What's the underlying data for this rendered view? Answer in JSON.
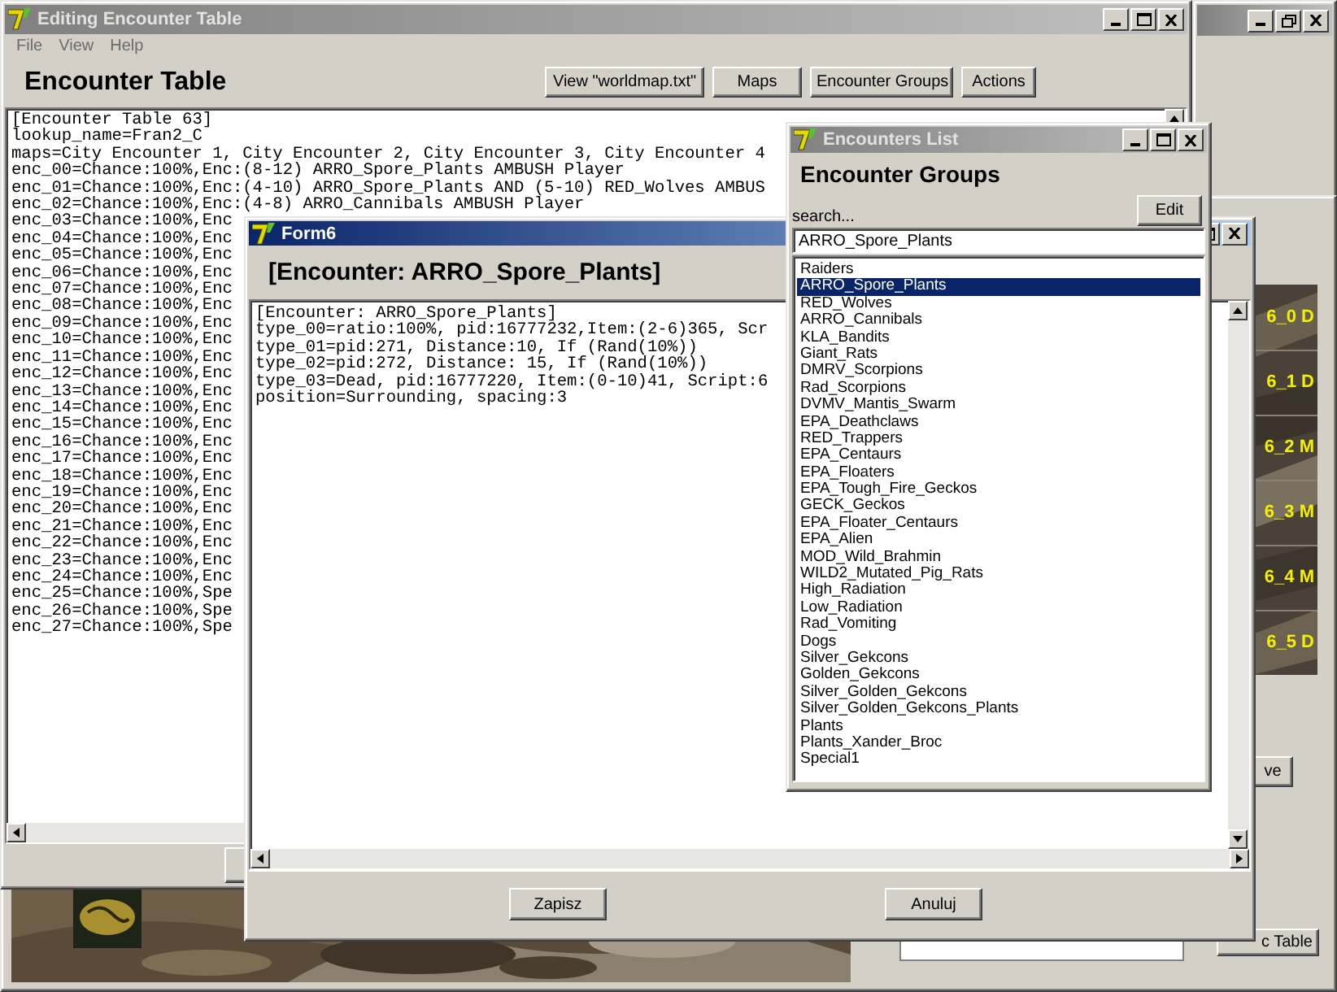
{
  "background_window": {
    "active": false
  },
  "main_window": {
    "title": "Editing Encounter Table",
    "active": false,
    "menu": [
      "File",
      "View",
      "Help"
    ],
    "heading": "Encounter Table",
    "buttons": [
      "View \"worldmap.txt\"",
      "Maps",
      "Encounter Groups",
      "Actions"
    ],
    "lines": [
      "[Encounter Table 63]",
      "lookup_name=Fran2_C",
      "maps=City Encounter 1, City Encounter 2, City Encounter 3, City Encounter 4",
      "enc_00=Chance:100%,Enc:(8-12) ARRO_Spore_Plants AMBUSH Player",
      "enc_01=Chance:100%,Enc:(4-10) ARRO_Spore_Plants AND (5-10) RED_Wolves AMBUS",
      "enc_02=Chance:100%,Enc:(4-8) ARRO_Cannibals AMBUSH Player",
      "enc_03=Chance:100%,Enc",
      "enc_04=Chance:100%,Enc",
      "enc_05=Chance:100%,Enc",
      "enc_06=Chance:100%,Enc",
      "enc_07=Chance:100%,Enc",
      "enc_08=Chance:100%,Enc",
      "enc_09=Chance:100%,Enc",
      "enc_10=Chance:100%,Enc",
      "enc_11=Chance:100%,Enc",
      "enc_12=Chance:100%,Enc",
      "enc_13=Chance:100%,Enc",
      "enc_14=Chance:100%,Enc",
      "enc_15=Chance:100%,Enc",
      "enc_16=Chance:100%,Enc",
      "enc_17=Chance:100%,Enc",
      "enc_18=Chance:100%,Enc",
      "enc_19=Chance:100%,Enc",
      "enc_20=Chance:100%,Enc",
      "enc_21=Chance:100%,Enc",
      "enc_22=Chance:100%,Enc",
      "enc_23=Chance:100%,Enc",
      "enc_24=Chance:100%,Enc",
      "enc_25=Chance:100%,Spe",
      "enc_26=Chance:100%,Spe",
      "enc_27=Chance:100%,Spe"
    ]
  },
  "map_window": {
    "tile_labels": [
      "6_0 D",
      "6_1 D",
      "6_2 M",
      "6_3 M",
      "6_4 M",
      "6_5 D"
    ],
    "side_button": "ve",
    "table_button": "c Table"
  },
  "form6": {
    "title": "Form6",
    "active": true,
    "heading": "[Encounter: ARRO_Spore_Plants]",
    "lines": [
      "[Encounter: ARRO_Spore_Plants]",
      "type_00=ratio:100%, pid:16777232,Item:(2-6)365, Scr",
      "type_01=pid:271, Distance:10, If (Rand(10%))",
      "type_02=pid:272, Distance: 15, If (Rand(10%))",
      "type_03=Dead, pid:16777220, Item:(0-10)41, Script:6",
      "position=Surrounding, spacing:3"
    ],
    "buttons": [
      "Zapisz",
      "Anuluj"
    ]
  },
  "encounters_list": {
    "title": "Encounters List",
    "active": false,
    "heading": "Encounter Groups",
    "search_label": "search...",
    "edit_button": "Edit",
    "search": {
      "value": "ARRO_Spore_Plants"
    },
    "items": [
      {
        "label": "Raiders",
        "selected": false
      },
      {
        "label": "ARRO_Spore_Plants",
        "selected": true
      },
      {
        "label": "RED_Wolves",
        "selected": false
      },
      {
        "label": "ARRO_Cannibals",
        "selected": false
      },
      {
        "label": "KLA_Bandits",
        "selected": false
      },
      {
        "label": "Giant_Rats",
        "selected": false
      },
      {
        "label": "DMRV_Scorpions",
        "selected": false
      },
      {
        "label": "Rad_Scorpions",
        "selected": false
      },
      {
        "label": "DVMV_Mantis_Swarm",
        "selected": false
      },
      {
        "label": "EPA_Deathclaws",
        "selected": false
      },
      {
        "label": "RED_Trappers",
        "selected": false
      },
      {
        "label": "EPA_Centaurs",
        "selected": false
      },
      {
        "label": "EPA_Floaters",
        "selected": false
      },
      {
        "label": "EPA_Tough_Fire_Geckos",
        "selected": false
      },
      {
        "label": "GECK_Geckos",
        "selected": false
      },
      {
        "label": "EPA_Floater_Centaurs",
        "selected": false
      },
      {
        "label": "EPA_Alien",
        "selected": false
      },
      {
        "label": "MOD_Wild_Brahmin",
        "selected": false
      },
      {
        "label": "WILD2_Mutated_Pig_Rats",
        "selected": false
      },
      {
        "label": "High_Radiation",
        "selected": false
      },
      {
        "label": "Low_Radiation",
        "selected": false
      },
      {
        "label": "Rad_Vomiting",
        "selected": false
      },
      {
        "label": "Dogs",
        "selected": false
      },
      {
        "label": "Silver_Gekcons",
        "selected": false
      },
      {
        "label": "Golden_Gekcons",
        "selected": false
      },
      {
        "label": "Silver_Golden_Gekcons",
        "selected": false
      },
      {
        "label": "Silver_Golden_Gekcons_Plants",
        "selected": false
      },
      {
        "label": "Plants",
        "selected": false
      },
      {
        "label": "Plants_Xander_Broc",
        "selected": false
      },
      {
        "label": "Special1",
        "selected": false
      }
    ]
  }
}
